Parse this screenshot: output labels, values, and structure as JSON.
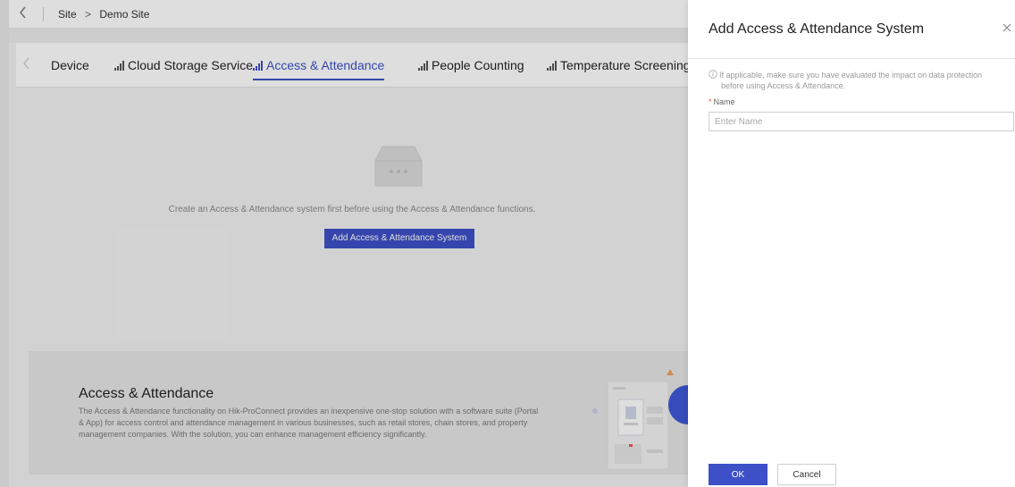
{
  "topbar": {
    "back_icon": "chevron-left-icon",
    "breadcrumb": {
      "root": "Site",
      "separator": ">",
      "current": "Demo Site"
    }
  },
  "tabs": [
    {
      "label": "Device",
      "icon": "",
      "active": false
    },
    {
      "label": "Cloud Storage Service",
      "icon": "signal-bars-icon",
      "active": false
    },
    {
      "label": "Access & Attendance",
      "icon": "signal-bars-icon",
      "active": true
    },
    {
      "label": "People Counting",
      "icon": "signal-bars-icon",
      "active": false
    },
    {
      "label": "Temperature Screening",
      "icon": "signal-bars-icon",
      "active": false
    }
  ],
  "empty_state": {
    "icon": "empty-box-icon",
    "message": "Create an Access & Attendance system first before using the Access & Attendance functions.",
    "button_label": "Add Access & Attendance System"
  },
  "info_card": {
    "title": "Access & Attendance",
    "description": "The Access & Attendance functionality on Hik-ProConnect provides an inexpensive one-stop solution with a software suite (Portal & App) for access control and attendance management in various businesses, such as retail stores, chain stores, and property management companies. With the solution, you can enhance management efficiency significantly."
  },
  "drawer": {
    "title": "Add Access & Attendance System",
    "notice_line1": "If applicable, make sure you have evaluated the impact on data protection",
    "notice_line2": "before using Access & Attendance.",
    "name_label": "Name",
    "name_required_mark": "*",
    "name_placeholder": "Enter Name",
    "name_value": "",
    "ok_label": "OK",
    "cancel_label": "Cancel"
  },
  "colors": {
    "accent": "#3d50c7",
    "required": "#e84a3c",
    "page_bg": "#f2f2f2",
    "card_bg": "#e6e6e6"
  }
}
